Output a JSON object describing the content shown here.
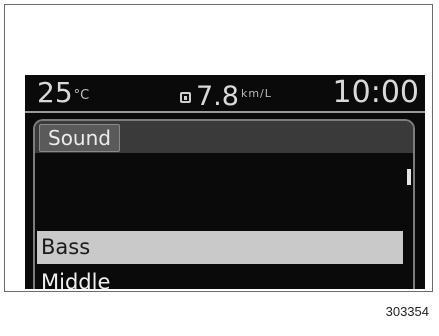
{
  "status_bar": {
    "temperature": "25",
    "temperature_unit": "°C",
    "fuel_economy": "7.8",
    "fuel_unit": "km/L",
    "clock": "10:00"
  },
  "menu": {
    "title": "Sound",
    "items": [
      {
        "label": "Bass",
        "selected": true
      },
      {
        "label": "Middle",
        "selected": false
      }
    ]
  },
  "figure_id": "303354",
  "colors": {
    "screen_bg": "#0a0a0a",
    "selected_bg": "#c9c9c9",
    "title_bar_bg": "#3a3a3a"
  }
}
